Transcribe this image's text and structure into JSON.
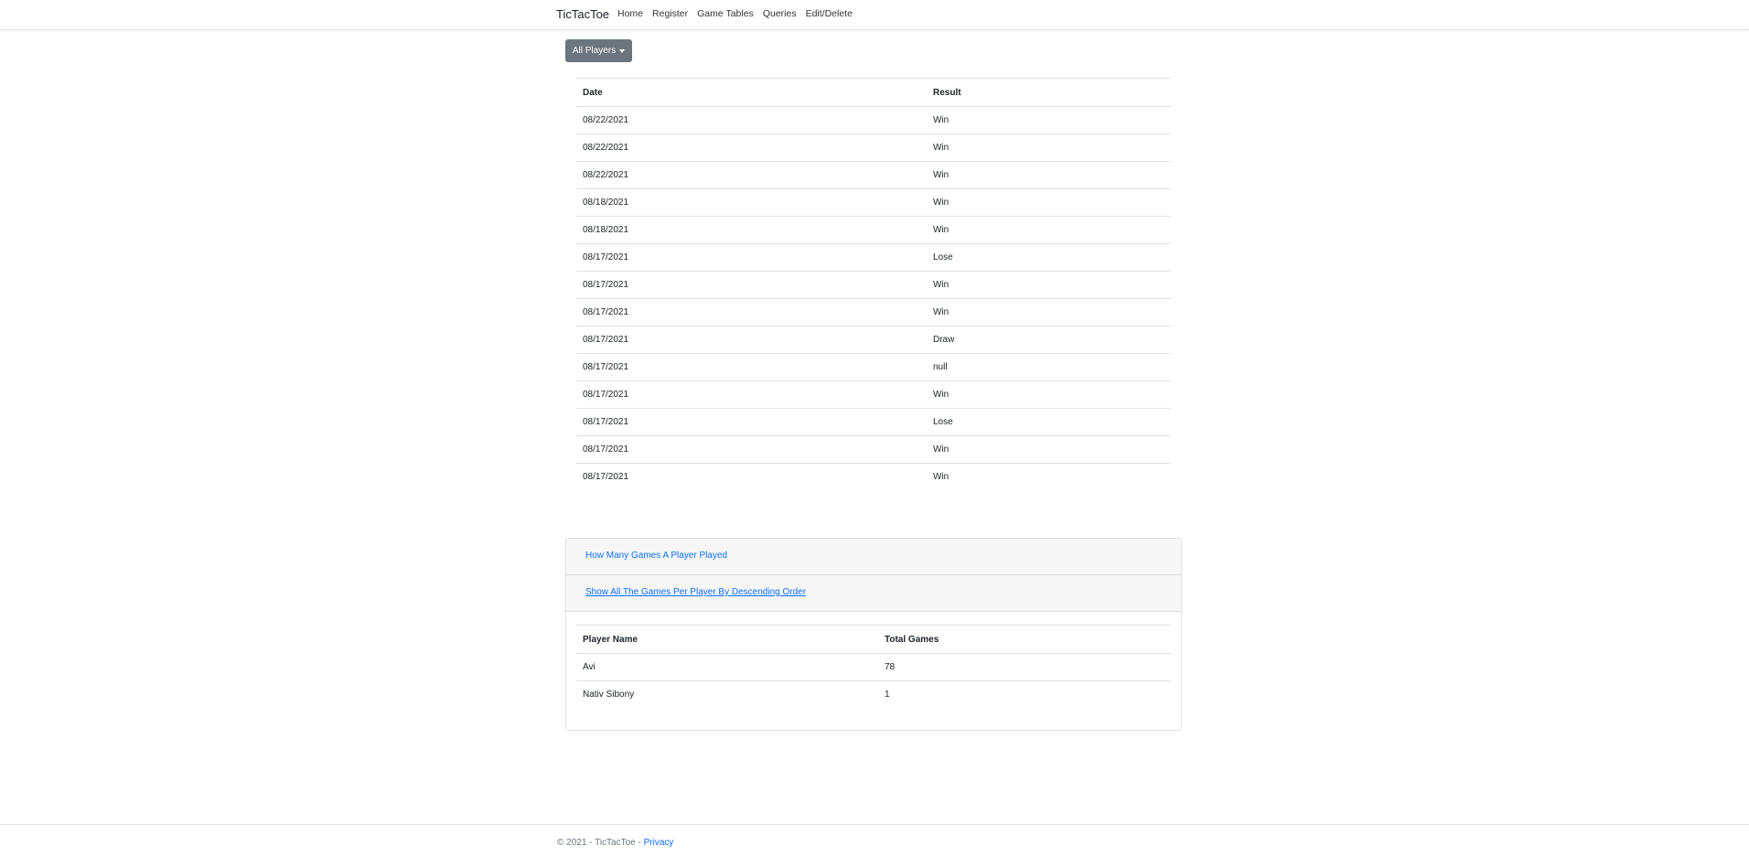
{
  "navbar": {
    "brand": "TicTacToe",
    "links": [
      "Home",
      "Register",
      "Game Tables",
      "Queries",
      "Edit/Delete"
    ]
  },
  "filter": {
    "label": "All Players"
  },
  "games_table": {
    "headers": [
      "Date",
      "Result"
    ],
    "rows": [
      [
        "08/22/2021",
        "Win"
      ],
      [
        "08/22/2021",
        "Win"
      ],
      [
        "08/22/2021",
        "Win"
      ],
      [
        "08/18/2021",
        "Win"
      ],
      [
        "08/18/2021",
        "Win"
      ],
      [
        "08/17/2021",
        "Lose"
      ],
      [
        "08/17/2021",
        "Win"
      ],
      [
        "08/17/2021",
        "Win"
      ],
      [
        "08/17/2021",
        "Draw"
      ],
      [
        "08/17/2021",
        "null"
      ],
      [
        "08/17/2021",
        "Win"
      ],
      [
        "08/17/2021",
        "Lose"
      ],
      [
        "08/17/2021",
        "Win"
      ],
      [
        "08/17/2021",
        "Win"
      ]
    ]
  },
  "queries": {
    "item1": "How Many Games A Player Played",
    "item2": "Show All The Games Per Player By Descending Order",
    "totals_table": {
      "headers": [
        "Player Name",
        "Total Games"
      ],
      "rows": [
        [
          "Avi",
          "78"
        ],
        [
          "Nativ Sibony",
          "1"
        ]
      ]
    }
  },
  "footer": {
    "copyright": "© 2021 - TicTacToe - ",
    "privacy": "Privacy"
  },
  "colors": {
    "button": "#6c757d",
    "link": "#0d6efd"
  }
}
